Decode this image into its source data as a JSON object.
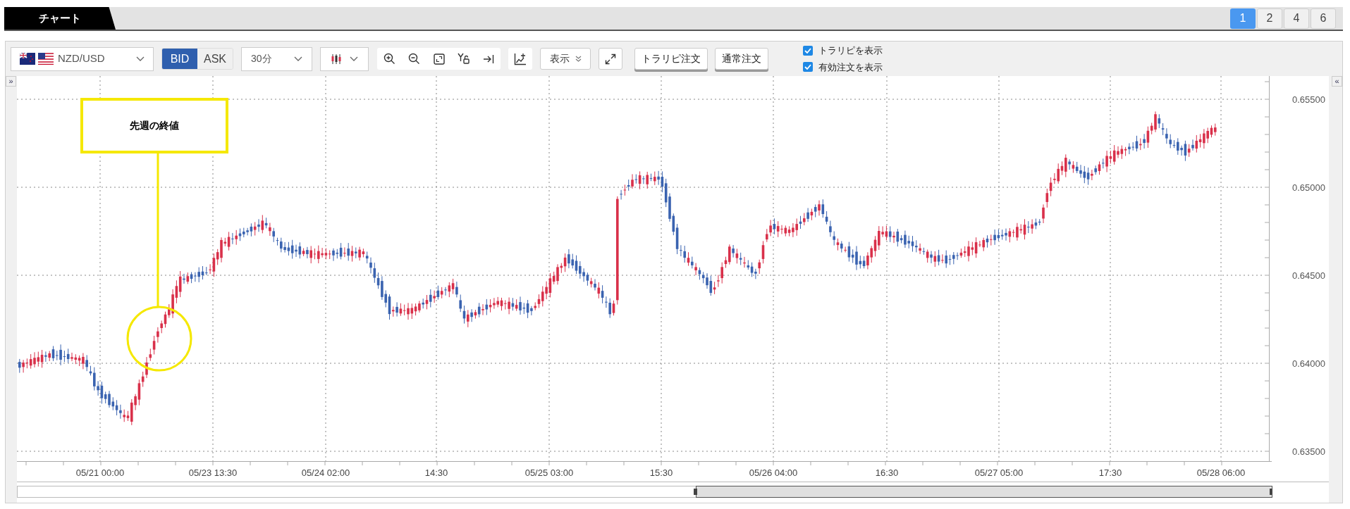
{
  "tab": {
    "label": "チャート"
  },
  "layouts": [
    {
      "label": "1",
      "selected": true
    },
    {
      "label": "2",
      "selected": false
    },
    {
      "label": "4",
      "selected": false
    },
    {
      "label": "6",
      "selected": false
    }
  ],
  "toolbar": {
    "symbol": "NZD/USD",
    "price_sides": [
      {
        "label": "BID",
        "selected": true
      },
      {
        "label": "ASK",
        "selected": false
      }
    ],
    "timeframe": "30分",
    "display_menu": "表示",
    "order_buttons": [
      "トラリピ注文",
      "通常注文"
    ],
    "checkboxes": [
      {
        "label": "トラリピを表示",
        "checked": true
      },
      {
        "label": "有効注文を表示",
        "checked": true
      }
    ]
  },
  "left_toggle": "»",
  "right_toggle": "«",
  "chart": {
    "y_labels": [
      "0.65500",
      "0.65000",
      "0.64500",
      "0.64000",
      "0.63500"
    ],
    "x_labels": [
      "05/21 00:00",
      "05/23 13:30",
      "05/24 02:00",
      "14:30",
      "05/25 03:00",
      "15:30",
      "05/26 04:00",
      "16:30",
      "05/27 05:00",
      "17:30",
      "05/28 06:00"
    ],
    "annotation": "先週の終値"
  }
}
